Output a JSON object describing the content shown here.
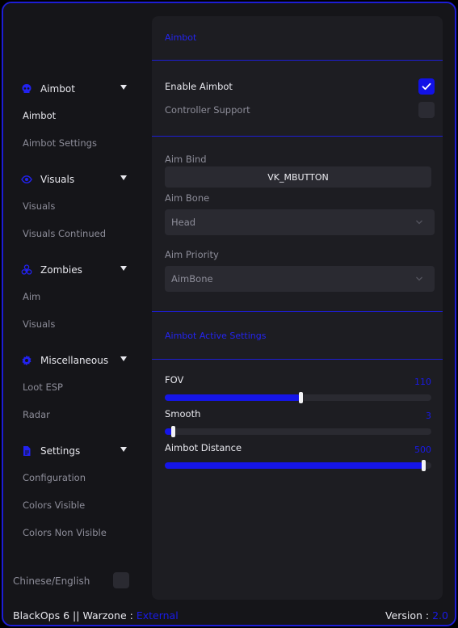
{
  "sidebar": {
    "categories": [
      {
        "label": "Aimbot",
        "icon": "skull-icon",
        "subs": [
          "Aimbot",
          "Aimbot Settings"
        ],
        "active_sub": 0
      },
      {
        "label": "Visuals",
        "icon": "eye-icon",
        "subs": [
          "Visuals",
          "Visuals Continued"
        ]
      },
      {
        "label": "Zombies",
        "icon": "biohazard-icon",
        "subs": [
          "Aim",
          "Visuals"
        ]
      },
      {
        "label": "Miscellaneous",
        "icon": "gear-icon",
        "subs": [
          "Loot ESP",
          "Radar"
        ]
      },
      {
        "label": "Settings",
        "icon": "file-icon",
        "subs": [
          "Configuration",
          "Colors Visible",
          "Colors Non Visible"
        ]
      }
    ],
    "lang_label": "Chinese/English"
  },
  "main": {
    "section_title": "Aimbot",
    "enable_aimbot": {
      "label": "Enable Aimbot",
      "checked": true
    },
    "controller_support": {
      "label": "Controller Support",
      "checked": false
    },
    "aim_bind": {
      "label": "Aim Bind",
      "value": "VK_MBUTTON"
    },
    "aim_bone": {
      "label": "Aim Bone",
      "value": "Head"
    },
    "aim_priority": {
      "label": "Aim Priority",
      "value": "AimBone"
    },
    "active_settings_title": "Aimbot Active Settings",
    "sliders": [
      {
        "label": "FOV",
        "value": "110",
        "fraction": 0.51
      },
      {
        "label": "Smooth",
        "value": "3",
        "fraction": 0.03
      },
      {
        "label": "Aimbot Distance",
        "value": "500",
        "fraction": 0.97
      }
    ]
  },
  "footer": {
    "game": "BlackOps 6",
    "sep1": "||",
    "mode": "Warzone",
    "sep2": ":",
    "type": "External",
    "version_label": "Version :",
    "version": "2.0"
  },
  "colors": {
    "accent": "#1a1ae8",
    "background": "#151519",
    "panel": "#1d1d22",
    "control": "#2a2a31"
  }
}
